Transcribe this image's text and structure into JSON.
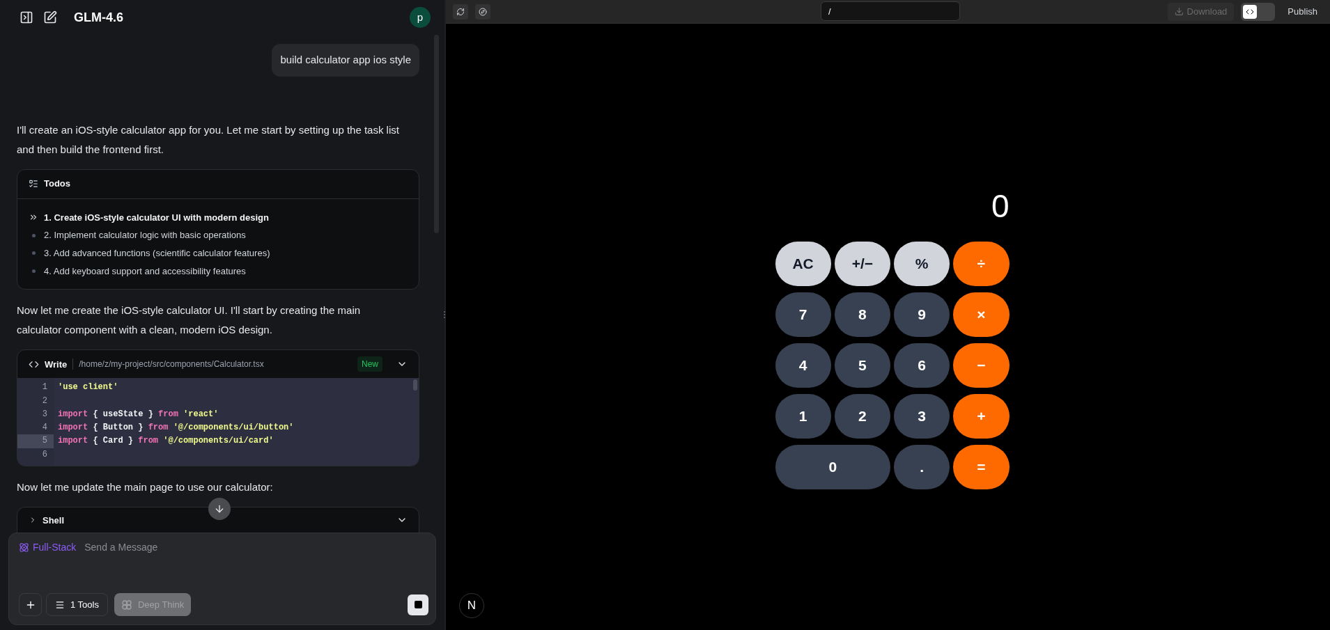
{
  "sidebar": {
    "title": "GLM-4.6",
    "avatar": "p"
  },
  "messages": [
    {
      "kind": "user",
      "text": "build calculator app ios style"
    },
    {
      "kind": "paragraph",
      "text": "I'll create an iOS-style calculator app for you. Let me start by setting up the task list and then build the frontend first."
    },
    {
      "kind": "todos",
      "title": "Todos",
      "items": [
        {
          "text": "1. Create iOS-style calculator UI with modern design",
          "current": true
        },
        {
          "text": "2. Implement calculator logic with basic operations",
          "current": false
        },
        {
          "text": "3. Add advanced functions (scientific calculator features)",
          "current": false
        },
        {
          "text": "4. Add keyboard support and accessibility features",
          "current": false
        }
      ]
    },
    {
      "kind": "paragraph",
      "text": "Now let me create the iOS-style calculator UI. I'll start by creating the main calculator component with a clean, modern iOS design."
    },
    {
      "kind": "write",
      "title": "Write",
      "path": "/home/z/my-project/src/components/Calculator.tsx",
      "badge": "New",
      "lines": [
        {
          "number": "1",
          "highlighted": false,
          "tokens": [
            {
              "text": "'use client'",
              "kind": "string"
            }
          ]
        },
        {
          "number": "2",
          "highlighted": false
        },
        {
          "number": "3",
          "highlighted": false,
          "tokens": [
            {
              "text": "import",
              "kind": "keyword"
            },
            {
              "text": " { useState } ",
              "kind": "plain"
            },
            {
              "text": "from",
              "kind": "keyword"
            },
            {
              "text": " 'react'",
              "kind": "string"
            }
          ]
        },
        {
          "number": "4",
          "highlighted": false,
          "tokens": [
            {
              "text": "import",
              "kind": "keyword"
            },
            {
              "text": " { Button } ",
              "kind": "plain"
            },
            {
              "text": "from",
              "kind": "keyword"
            },
            {
              "text": " '@/components/ui/button'",
              "kind": "string"
            }
          ]
        },
        {
          "number": "5",
          "highlighted": true,
          "tokens": [
            {
              "text": "import",
              "kind": "keyword"
            },
            {
              "text": " { Card } ",
              "kind": "plain"
            },
            {
              "text": "from",
              "kind": "keyword"
            },
            {
              "text": " '@/components/ui/card'",
              "kind": "string"
            }
          ]
        },
        {
          "number": "6",
          "highlighted": false
        }
      ]
    },
    {
      "kind": "paragraph",
      "text": "Now let me update the main page to use our calculator:"
    },
    {
      "kind": "shell",
      "title": "Shell"
    }
  ],
  "composer": {
    "mode": "Full-Stack",
    "placeholder": "Send a Message",
    "tools": "1 Tools",
    "deep_think": {
      "label": "Deep Think",
      "on": false
    }
  },
  "preview": {
    "address": "/",
    "download": {
      "label": "Download",
      "disabled": true
    },
    "code_view": {
      "on": false
    },
    "publish": "Publish",
    "calculator": {
      "display": "0",
      "keys": [
        {
          "label": "AC",
          "kind": "function",
          "wide": false
        },
        {
          "label": "+/−",
          "kind": "function",
          "wide": false
        },
        {
          "label": "%",
          "kind": "function",
          "wide": false
        },
        {
          "label": "÷",
          "kind": "operator",
          "wide": false
        },
        {
          "label": "7",
          "kind": "digit",
          "wide": false
        },
        {
          "label": "8",
          "kind": "digit",
          "wide": false
        },
        {
          "label": "9",
          "kind": "digit",
          "wide": false
        },
        {
          "label": "×",
          "kind": "operator",
          "wide": false
        },
        {
          "label": "4",
          "kind": "digit",
          "wide": false
        },
        {
          "label": "5",
          "kind": "digit",
          "wide": false
        },
        {
          "label": "6",
          "kind": "digit",
          "wide": false
        },
        {
          "label": "−",
          "kind": "operator",
          "wide": false
        },
        {
          "label": "1",
          "kind": "digit",
          "wide": false
        },
        {
          "label": "2",
          "kind": "digit",
          "wide": false
        },
        {
          "label": "3",
          "kind": "digit",
          "wide": false
        },
        {
          "label": "+",
          "kind": "operator",
          "wide": false
        },
        {
          "label": "0",
          "kind": "digit",
          "wide": true
        },
        {
          "label": ".",
          "kind": "digit",
          "wide": false
        },
        {
          "label": "=",
          "kind": "operator",
          "wide": false
        }
      ]
    },
    "framework_badge": "N"
  }
}
